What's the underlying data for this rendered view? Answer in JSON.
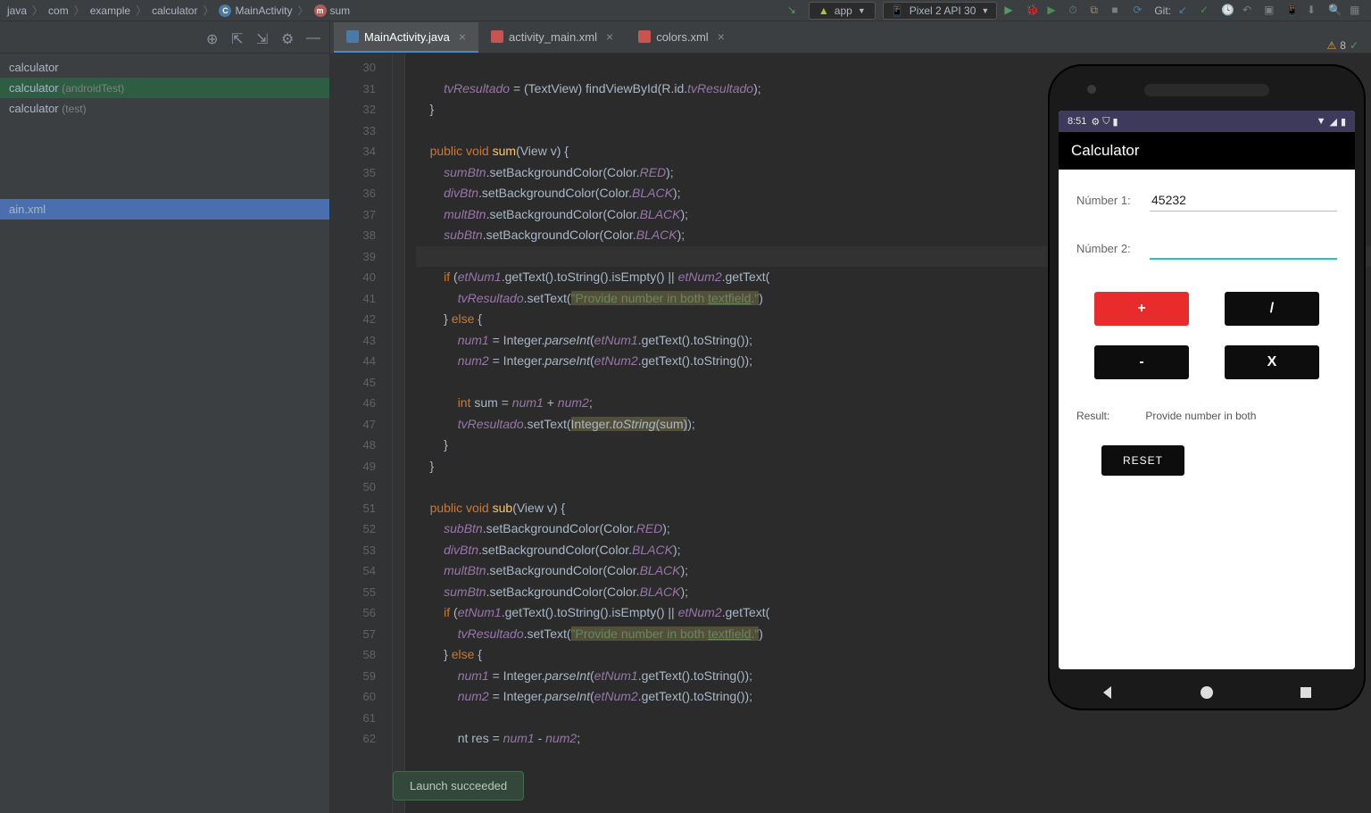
{
  "breadcrumb": [
    "java",
    "com",
    "example",
    "calculator",
    "MainActivity",
    "sum"
  ],
  "runConfig": {
    "app": "app",
    "device": "Pixel 2 API 30"
  },
  "gitLabel": "Git:",
  "sidebar": {
    "items": [
      {
        "label": "calculator",
        "ann": ""
      },
      {
        "label": "calculator",
        "ann": "(androidTest)"
      },
      {
        "label": "calculator",
        "ann": "(test)"
      }
    ],
    "file": "ain.xml"
  },
  "tabs": [
    {
      "label": "MainActivity.java",
      "type": "java",
      "active": true
    },
    {
      "label": "activity_main.xml",
      "type": "xml",
      "active": false
    },
    {
      "label": "colors.xml",
      "type": "xml",
      "active": false
    }
  ],
  "warnings": {
    "count": "8"
  },
  "gutter": [
    "30",
    "31",
    "32",
    "33",
    "34",
    "35",
    "36",
    "37",
    "38",
    "39",
    "40",
    "41",
    "42",
    "43",
    "44",
    "45",
    "46",
    "47",
    "48",
    "49",
    "50",
    "51",
    "52",
    "53",
    "54",
    "55",
    "56",
    "57",
    "58",
    "59",
    "60",
    "61",
    "62"
  ],
  "code": {
    "l31_a": "tvResultado",
    "l31_b": " = (TextView) findViewById(R.id.",
    "l31_c": "tvResultado",
    "l31_d": ");",
    "l34_a": "public void ",
    "l34_b": "sum",
    "l34_c": "(View v) {",
    "l35_a": "sumBtn",
    "l35_b": ".setBackgroundColor(Color.",
    "l35_c": "RED",
    "l35_d": ");",
    "l36_a": "divBtn",
    "l36_c": "BLACK",
    "l37_a": "multBtn",
    "l38_a": "subBtn",
    "l40_a": "if ",
    "l40_b": "(",
    "l40_c": "etNum1",
    "l40_d": ".getText().toString().isEmpty() || ",
    "l40_e": "etNum2",
    "l40_f": ".getText(",
    "l41_a": "tvResultado",
    "l41_b": ".setText(",
    "l41_c": "\"Provide number in both ",
    "l41_d": "textfield",
    "l41_e": ".\"",
    "l41_f": ")",
    "l42_a": "} ",
    "l42_b": "else ",
    "l42_c": "{",
    "l43_a": "num1",
    "l43_b": " = Integer.",
    "l43_c": "parseInt",
    "l43_d": "(",
    "l43_e": "etNum1",
    "l43_f": ".getText().toString());",
    "l44_a": "num2",
    "l44_e": "etNum2",
    "l46_a": "int ",
    "l46_b": "sum = ",
    "l46_c": "num1",
    "l46_d": " + ",
    "l46_e": "num2",
    "l46_f": ";",
    "l47_a": "tvResultado",
    "l47_b": ".setText(",
    "l47_c": "Integer.",
    "l47_d": "toString",
    "l47_e": "(sum)",
    "l47_f": ");",
    "l51_b": "sub",
    "l62_a": "nt ",
    "l62_b": "res = ",
    "l62_c": "num1",
    "l62_d": " - ",
    "l62_e": "num2",
    "l62_f": ";"
  },
  "toast": "Launch succeeded",
  "emulator": {
    "time": "8:51",
    "title": "Calculator",
    "num1Label": "Númber 1:",
    "num1Value": "45232",
    "num2Label": "Númber 2:",
    "num2Value": "",
    "ops": {
      "add": "+",
      "div": "/",
      "sub": "-",
      "mul": "X"
    },
    "resultLabel": "Result:",
    "resultValue": "Provide number in both",
    "reset": "RESET"
  }
}
